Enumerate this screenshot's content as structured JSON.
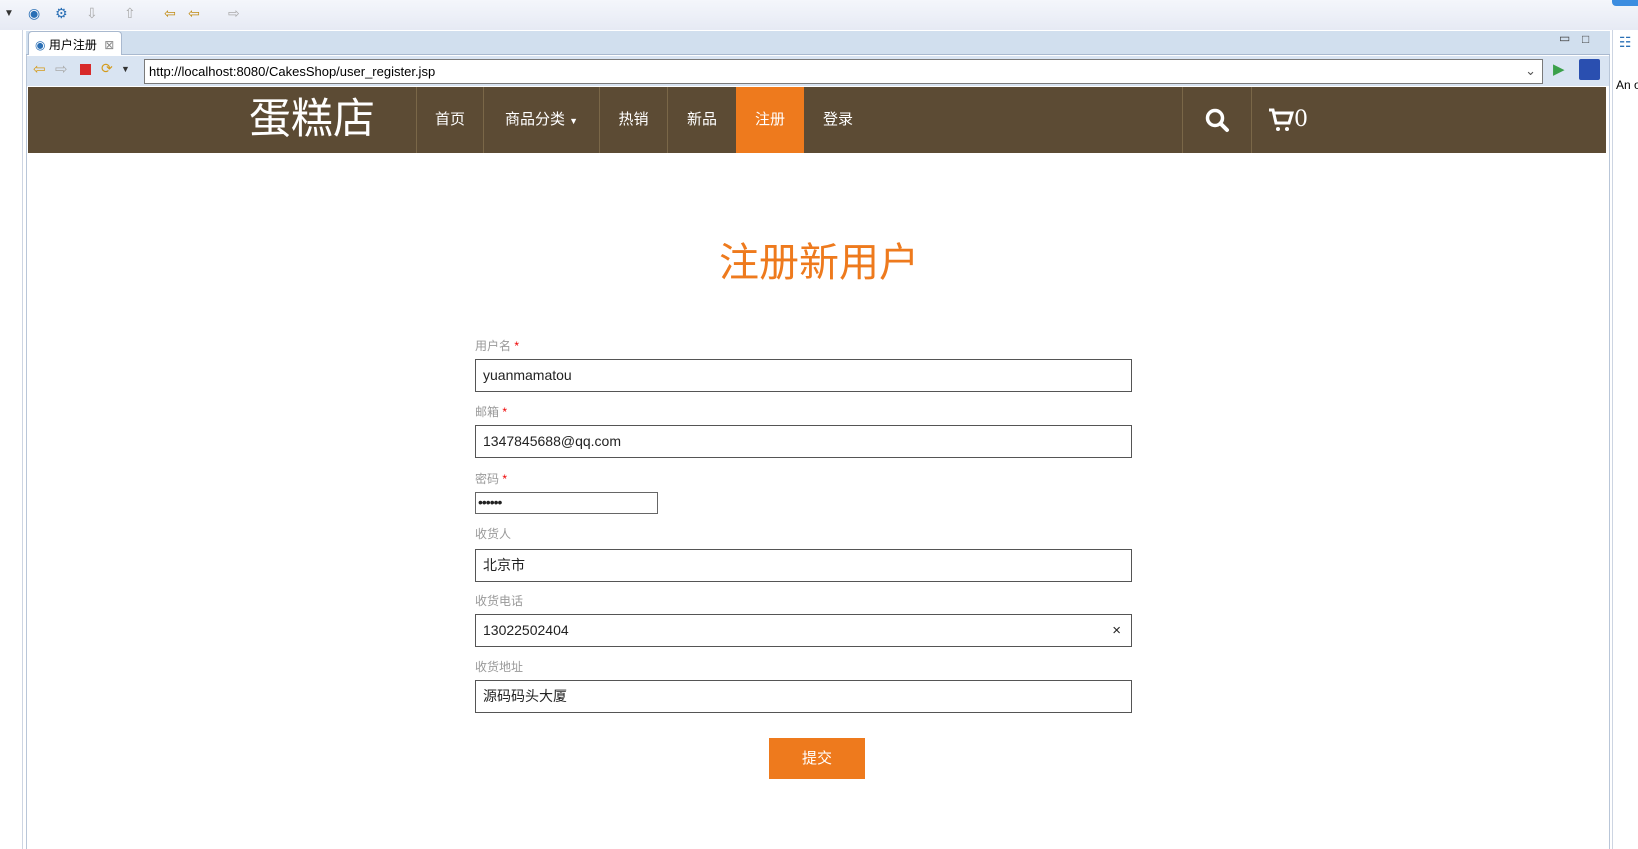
{
  "ide": {
    "tab_title": "用户注册",
    "url": "http://localhost:8080/CakesShop/user_register.jsp",
    "right_panel_text": "An o"
  },
  "site": {
    "logo": "蛋糕店",
    "nav": [
      {
        "label": "首页"
      },
      {
        "label": "商品分类"
      },
      {
        "label": "热销"
      },
      {
        "label": "新品"
      },
      {
        "label": "注册"
      },
      {
        "label": "登录"
      }
    ],
    "cart_count": "0",
    "colors": {
      "nav_bg": "#5c4b34",
      "accent": "#ee7a1d"
    }
  },
  "form": {
    "title": "注册新用户",
    "username": {
      "label": "用户名",
      "value": "yuanmamatou"
    },
    "email": {
      "label": "邮箱",
      "value": "1347845688@qq.com"
    },
    "password": {
      "label": "密码",
      "value": "••••••"
    },
    "receiver": {
      "label": "收货人",
      "value": "北京市"
    },
    "phone": {
      "label": "收货电话",
      "value": "13022502404"
    },
    "address": {
      "label": "收货地址",
      "value": "源码码头大厦"
    },
    "required_mark": "*",
    "clear_icon": "×",
    "submit": "提交"
  }
}
